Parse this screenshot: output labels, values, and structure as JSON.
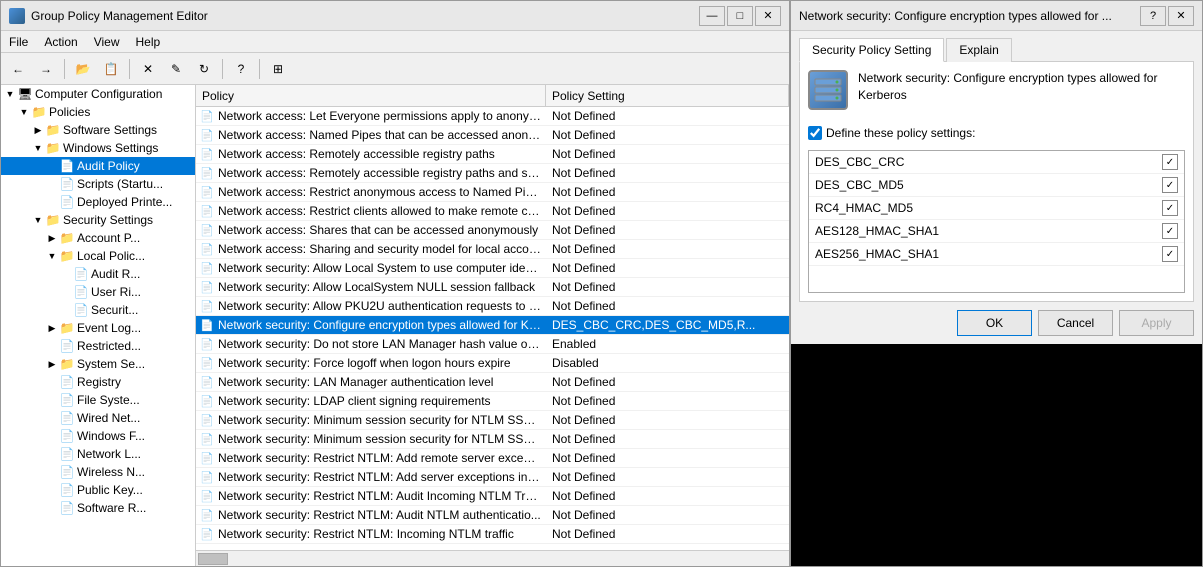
{
  "gpo_window": {
    "title": "Group Policy Management Editor",
    "menu": [
      "File",
      "Action",
      "View",
      "Help"
    ],
    "tree": {
      "items": [
        {
          "id": "computer-config",
          "label": "Computer Configuration",
          "indent": 0,
          "expanded": true,
          "hasExpand": true,
          "icon": "🖥"
        },
        {
          "id": "policies",
          "label": "Policies",
          "indent": 1,
          "expanded": true,
          "hasExpand": true,
          "icon": "📁"
        },
        {
          "id": "software-settings",
          "label": "Software Settings",
          "indent": 2,
          "expanded": false,
          "hasExpand": true,
          "icon": "📁"
        },
        {
          "id": "windows-settings",
          "label": "Windows Settings",
          "indent": 2,
          "expanded": true,
          "hasExpand": true,
          "icon": "📁"
        },
        {
          "id": "audit-policy",
          "label": "Audit Policy",
          "indent": 3,
          "expanded": false,
          "hasExpand": false,
          "icon": "📄",
          "selected": true
        },
        {
          "id": "scripts",
          "label": "Scripts (Startu...",
          "indent": 3,
          "expanded": false,
          "hasExpand": false,
          "icon": "📄"
        },
        {
          "id": "deployed-printers",
          "label": "Deployed Printe...",
          "indent": 3,
          "expanded": false,
          "hasExpand": false,
          "icon": "📄"
        },
        {
          "id": "security-settings",
          "label": "Security Settings",
          "indent": 3,
          "expanded": true,
          "hasExpand": true,
          "icon": "📁"
        },
        {
          "id": "account-policies",
          "label": "Account P...",
          "indent": 4,
          "expanded": false,
          "hasExpand": true,
          "icon": "📁"
        },
        {
          "id": "local-policies",
          "label": "Local Polic...",
          "indent": 4,
          "expanded": true,
          "hasExpand": true,
          "icon": "📁"
        },
        {
          "id": "audit-r",
          "label": "Audit R...",
          "indent": 5,
          "expanded": false,
          "hasExpand": false,
          "icon": "📄"
        },
        {
          "id": "user-ri",
          "label": "User Ri...",
          "indent": 5,
          "expanded": false,
          "hasExpand": false,
          "icon": "📄"
        },
        {
          "id": "security-o",
          "label": "Securit...",
          "indent": 5,
          "expanded": false,
          "hasExpand": false,
          "selected2": true,
          "icon": "📄"
        },
        {
          "id": "event-log",
          "label": "Event Log...",
          "indent": 4,
          "expanded": false,
          "hasExpand": true,
          "icon": "📁"
        },
        {
          "id": "restricted",
          "label": "Restricted...",
          "indent": 4,
          "expanded": false,
          "hasExpand": false,
          "icon": "📄"
        },
        {
          "id": "system-se",
          "label": "System Se...",
          "indent": 4,
          "expanded": false,
          "hasExpand": true,
          "icon": "📁"
        },
        {
          "id": "registry",
          "label": "Registry",
          "indent": 4,
          "expanded": false,
          "hasExpand": false,
          "icon": "📄"
        },
        {
          "id": "file-system",
          "label": "File Syste...",
          "indent": 4,
          "expanded": false,
          "hasExpand": false,
          "icon": "📄"
        },
        {
          "id": "wired-net",
          "label": "Wired Net...",
          "indent": 4,
          "expanded": false,
          "hasExpand": false,
          "icon": "📄"
        },
        {
          "id": "windows-f",
          "label": "Windows F...",
          "indent": 4,
          "expanded": false,
          "hasExpand": false,
          "icon": "📄"
        },
        {
          "id": "network-l",
          "label": "Network L...",
          "indent": 4,
          "expanded": false,
          "hasExpand": false,
          "icon": "📄"
        },
        {
          "id": "wireless-n",
          "label": "Wireless N...",
          "indent": 4,
          "expanded": false,
          "hasExpand": false,
          "icon": "📄"
        },
        {
          "id": "public-key",
          "label": "Public Key...",
          "indent": 4,
          "expanded": false,
          "hasExpand": false,
          "icon": "📄"
        },
        {
          "id": "software-r",
          "label": "Software R...",
          "indent": 4,
          "expanded": false,
          "hasExpand": false,
          "icon": "📄"
        }
      ]
    },
    "list": {
      "col_policy": "Policy",
      "col_setting": "Policy Setting",
      "rows": [
        {
          "policy": "Network access: Let Everyone permissions apply to anonym...",
          "setting": "Not Defined",
          "selected": false
        },
        {
          "policy": "Network access: Named Pipes that can be accessed anonym...",
          "setting": "Not Defined",
          "selected": false
        },
        {
          "policy": "Network access: Remotely accessible registry paths",
          "setting": "Not Defined",
          "selected": false
        },
        {
          "policy": "Network access: Remotely accessible registry paths and sub...",
          "setting": "Not Defined",
          "selected": false
        },
        {
          "policy": "Network access: Restrict anonymous access to Named Pipes...",
          "setting": "Not Defined",
          "selected": false
        },
        {
          "policy": "Network access: Restrict clients allowed to make remote call...",
          "setting": "Not Defined",
          "selected": false
        },
        {
          "policy": "Network access: Shares that can be accessed anonymously",
          "setting": "Not Defined",
          "selected": false
        },
        {
          "policy": "Network access: Sharing and security model for local accou...",
          "setting": "Not Defined",
          "selected": false
        },
        {
          "policy": "Network security: Allow Local System to use computer ident...",
          "setting": "Not Defined",
          "selected": false
        },
        {
          "policy": "Network security: Allow LocalSystem NULL session fallback",
          "setting": "Not Defined",
          "selected": false
        },
        {
          "policy": "Network security: Allow PKU2U authentication requests to t...",
          "setting": "Not Defined",
          "selected": false
        },
        {
          "policy": "Network security: Configure encryption types allowed for Ke...",
          "setting": "DES_CBC_CRC,DES_CBC_MD5,R...",
          "selected": true
        },
        {
          "policy": "Network security: Do not store LAN Manager hash value on ...",
          "setting": "Enabled",
          "selected": false
        },
        {
          "policy": "Network security: Force logoff when logon hours expire",
          "setting": "Disabled",
          "selected": false
        },
        {
          "policy": "Network security: LAN Manager authentication level",
          "setting": "Not Defined",
          "selected": false
        },
        {
          "policy": "Network security: LDAP client signing requirements",
          "setting": "Not Defined",
          "selected": false
        },
        {
          "policy": "Network security: Minimum session security for NTLM SSP ...",
          "setting": "Not Defined",
          "selected": false
        },
        {
          "policy": "Network security: Minimum session security for NTLM SSP ...",
          "setting": "Not Defined",
          "selected": false
        },
        {
          "policy": "Network security: Restrict NTLM: Add remote server excepti...",
          "setting": "Not Defined",
          "selected": false
        },
        {
          "policy": "Network security: Restrict NTLM: Add server exceptions in t...",
          "setting": "Not Defined",
          "selected": false
        },
        {
          "policy": "Network security: Restrict NTLM: Audit Incoming NTLM Tra...",
          "setting": "Not Defined",
          "selected": false
        },
        {
          "policy": "Network security: Restrict NTLM: Audit NTLM authenticatio...",
          "setting": "Not Defined",
          "selected": false
        },
        {
          "policy": "Network security: Restrict NTLM: Incoming NTLM traffic",
          "setting": "Not Defined",
          "selected": false
        }
      ]
    }
  },
  "dialog": {
    "title": "Network security: Configure encryption types allowed for ...",
    "tabs": [
      "Security Policy Setting",
      "Explain"
    ],
    "active_tab": "Security Policy Setting",
    "icon_label": "🖥",
    "policy_name": "Network security: Configure encryption types allowed for Kerberos",
    "checkbox_label": "Define these policy settings:",
    "checkbox_checked": true,
    "encryption_types": [
      {
        "label": "DES_CBC_CRC",
        "checked": true
      },
      {
        "label": "DES_CBC_MD5",
        "checked": true
      },
      {
        "label": "RC4_HMAC_MD5",
        "checked": true
      },
      {
        "label": "AES128_HMAC_SHA1",
        "checked": true
      },
      {
        "label": "AES256_HMAC_SHA1",
        "checked": true
      }
    ],
    "buttons": {
      "ok": "OK",
      "cancel": "Cancel",
      "apply": "Apply"
    }
  }
}
